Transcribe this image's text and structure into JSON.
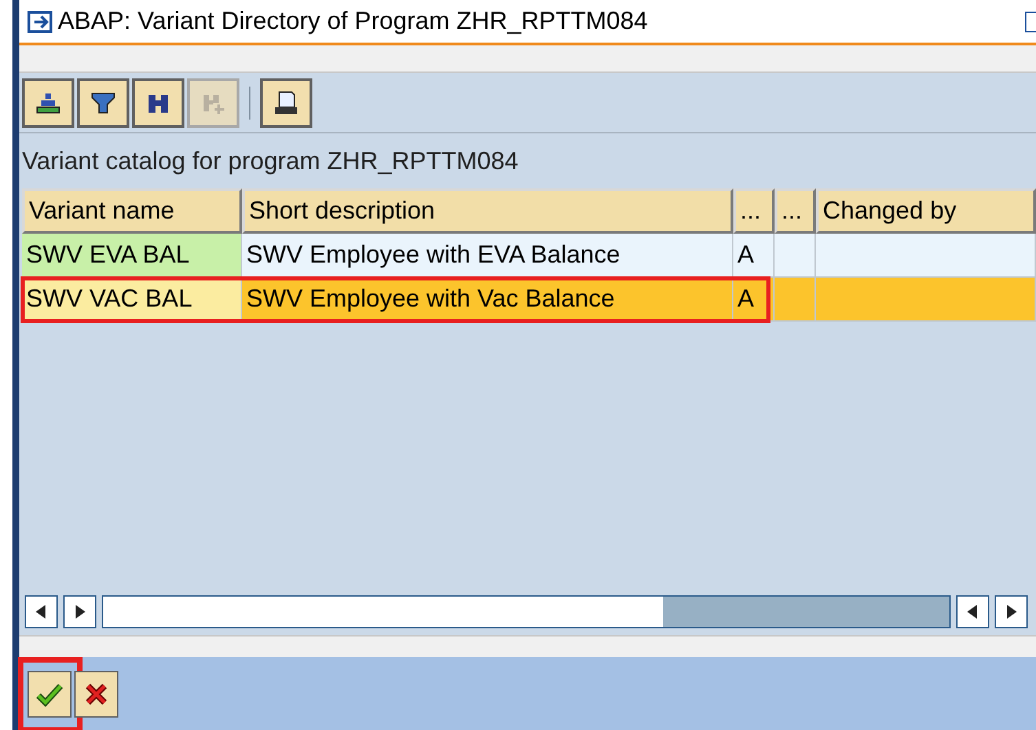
{
  "window": {
    "title": "ABAP: Variant Directory of Program ZHR_RPTTM084"
  },
  "toolbar": [
    {
      "kind": "sort",
      "disabled": false
    },
    {
      "kind": "filter",
      "disabled": false
    },
    {
      "kind": "find",
      "disabled": false
    },
    {
      "kind": "find_next",
      "disabled": true
    },
    {
      "kind": "print",
      "disabled": false
    }
  ],
  "catalog_label": "Variant catalog for program ZHR_RPTTM084",
  "table": {
    "columns": [
      "Variant name",
      "Short description",
      "...",
      "...",
      "Changed by"
    ],
    "rows": [
      {
        "cells": [
          "SWV EVA BAL",
          "SWV Employee with EVA Balance",
          "A"
        ],
        "selected": false,
        "highlighted": false
      },
      {
        "cells": [
          "SWV VAC BAL",
          "SWV Employee with Vac  Balance",
          "A"
        ],
        "selected": true,
        "highlighted": true
      }
    ]
  },
  "footer_buttons": [
    {
      "kind": "ok",
      "highlighted": true
    },
    {
      "kind": "cancel",
      "highlighted": false
    }
  ]
}
